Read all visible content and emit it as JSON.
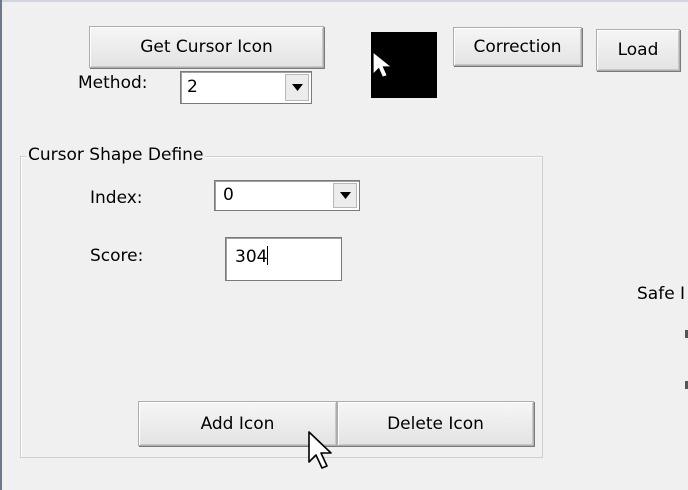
{
  "toolbar": {
    "get_cursor_icon_label": "Get Cursor Icon",
    "correction_label": "Correction",
    "load_label": "Load"
  },
  "method": {
    "label": "Method:",
    "value": "2"
  },
  "cursor_shape_define": {
    "title": "Cursor Shape Define",
    "index_label": "Index:",
    "index_value": "0",
    "score_label": "Score:",
    "score_value": "304",
    "add_icon_label": "Add Icon",
    "delete_icon_label": "Delete Icon"
  },
  "right_panel": {
    "safe_label_partial": "Safe I"
  },
  "icons": {
    "preview": "cursor-preview-icon",
    "dropdown": "chevron-down-icon",
    "mouse_pointer": "mouse-pointer-icon"
  }
}
